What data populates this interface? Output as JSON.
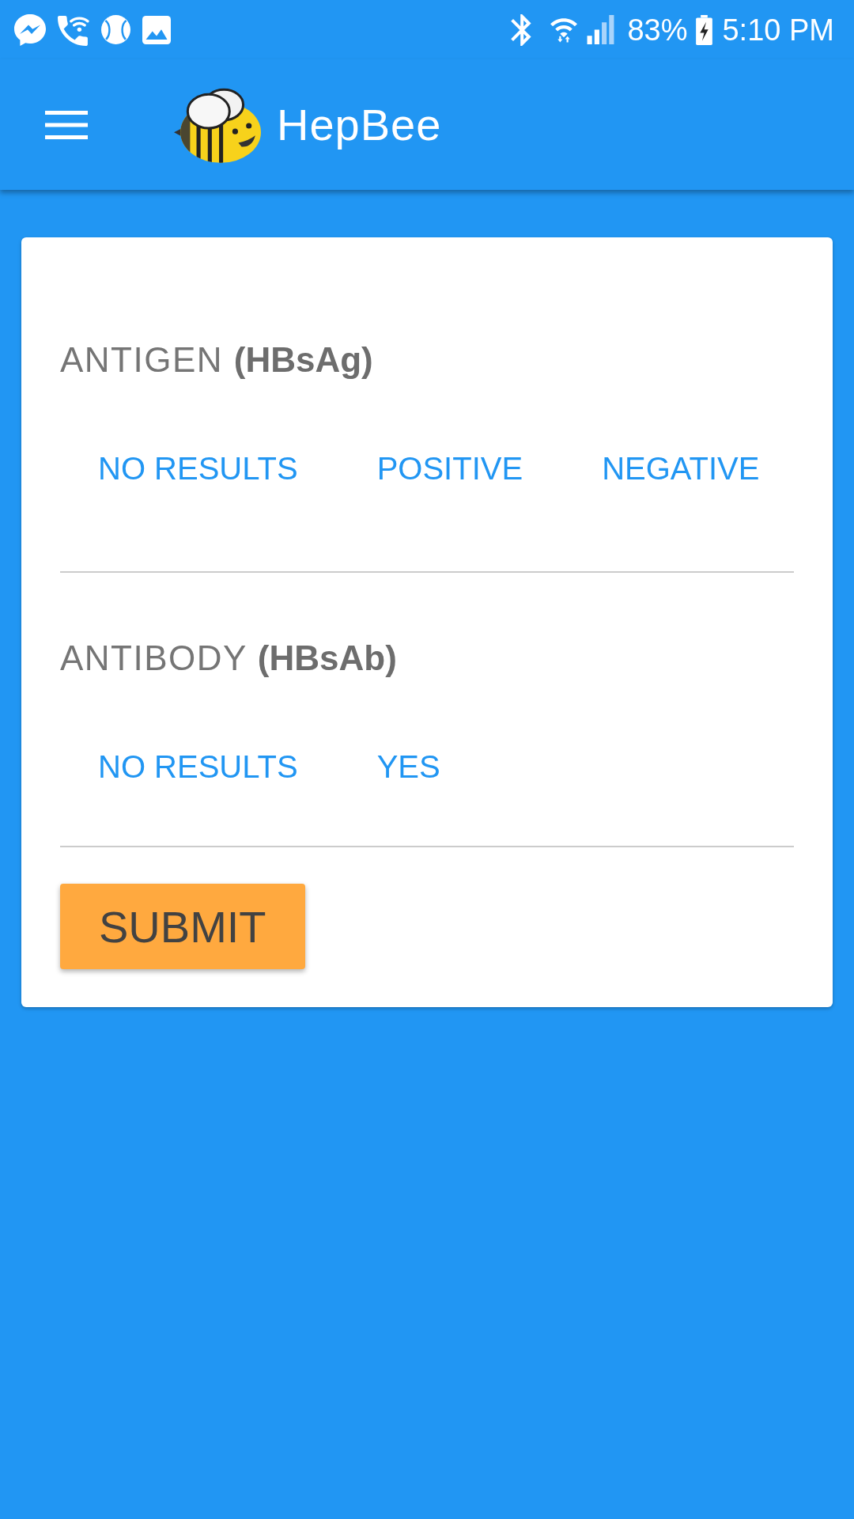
{
  "status_bar": {
    "battery": "83%",
    "time": "5:10 PM"
  },
  "app_bar": {
    "title": "HepBee"
  },
  "form": {
    "sections": [
      {
        "label": "ANTIGEN **(HBsAg)**",
        "options": [
          "NO RESULTS",
          "POSITIVE",
          "NEGATIVE"
        ]
      },
      {
        "label": "ANTIBODY **(HBsAb)**",
        "options": [
          "NO RESULTS",
          "YES"
        ]
      }
    ],
    "submit": "SUBMIT"
  }
}
